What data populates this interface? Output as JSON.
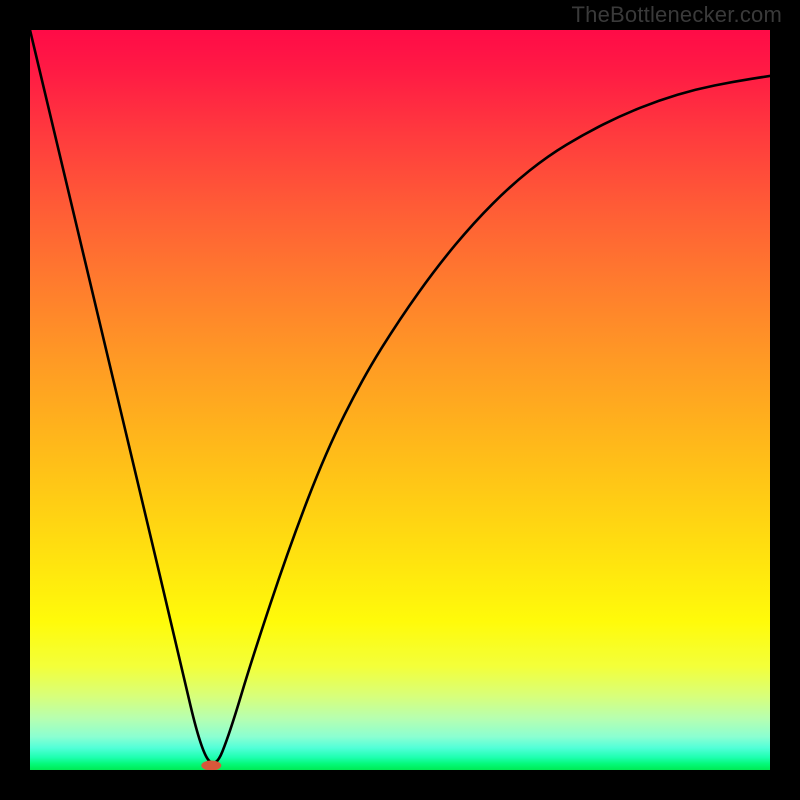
{
  "watermark": "TheBottlenecker.com",
  "chart_data": {
    "type": "line",
    "title": "",
    "xlabel": "",
    "ylabel": "",
    "xlim": [
      0,
      100
    ],
    "ylim": [
      0,
      100
    ],
    "grid": false,
    "legend": false,
    "series": [
      {
        "name": "bottleneck-curve",
        "x": [
          0,
          5,
          10,
          15,
          20,
          23,
          25,
          27,
          30,
          35,
          40,
          45,
          50,
          55,
          60,
          65,
          70,
          75,
          80,
          85,
          90,
          95,
          100
        ],
        "y": [
          100,
          79,
          58,
          37,
          16,
          3,
          0,
          5,
          15,
          30,
          43,
          53,
          61,
          68,
          74,
          79,
          83,
          86,
          88.5,
          90.5,
          92,
          93,
          93.8
        ]
      }
    ],
    "marker": {
      "x": 24.5,
      "y": 0.6,
      "label": "optimal-point"
    },
    "background": {
      "type": "vertical-gradient",
      "stops": [
        {
          "pos": 0.0,
          "color": "#ff0b47"
        },
        {
          "pos": 0.5,
          "color": "#ffb31c"
        },
        {
          "pos": 0.8,
          "color": "#fffb0a"
        },
        {
          "pos": 1.0,
          "color": "#00ea54"
        }
      ]
    }
  }
}
